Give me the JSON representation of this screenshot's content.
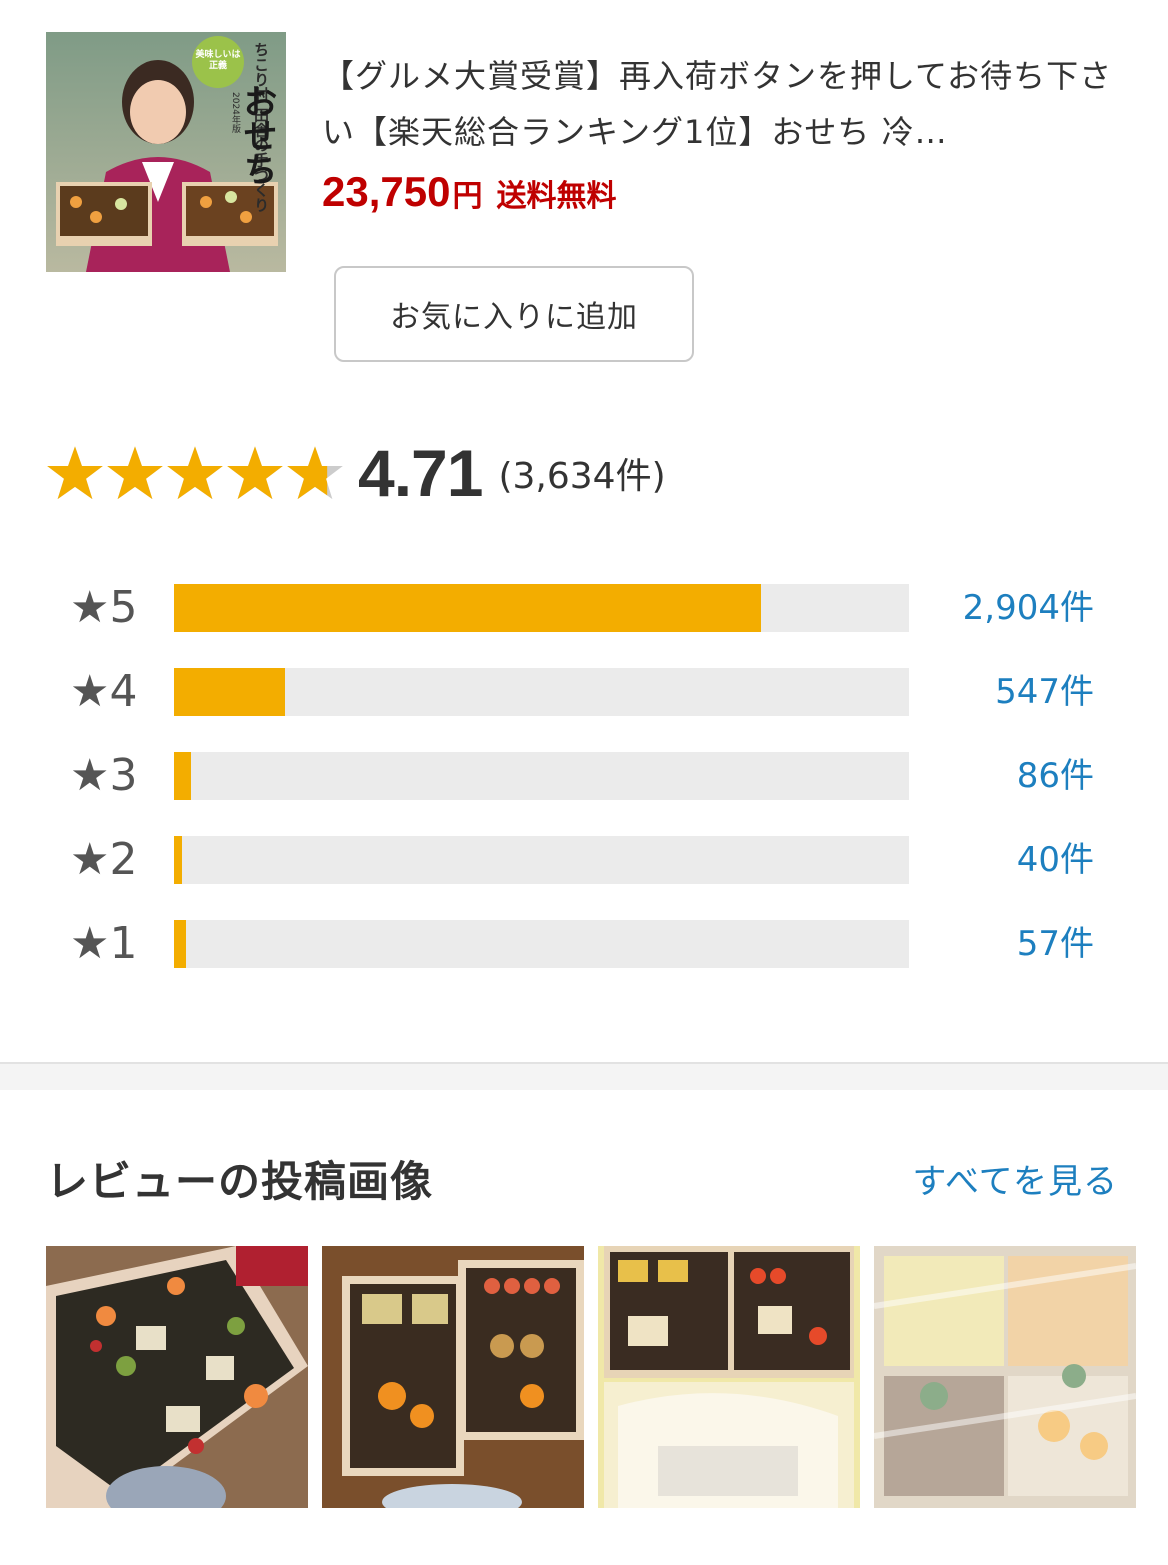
{
  "product": {
    "title": "【グルメ大賞受賞】再入荷ボタンを押してお待ち下さい【楽天総合ランキング1位】おせち 冷…",
    "price": "23,750",
    "price_unit": "円",
    "shipping": "送料無料",
    "thumbnail": {
      "badge_text": "美味しいは正義",
      "brand_text": "ちこり村 田舎の手づくり",
      "year_text": "2024年版",
      "osechi_text": "おせち"
    }
  },
  "favorite_button": {
    "label": "お気に入りに追加"
  },
  "rating": {
    "score": "4.71",
    "stars_value": 4.71,
    "count": "(3,634件)"
  },
  "distribution": [
    {
      "label": "★5",
      "count": "2,904件",
      "value": 2904
    },
    {
      "label": "★4",
      "count": "547件",
      "value": 547
    },
    {
      "label": "★3",
      "count": "86件",
      "value": 86
    },
    {
      "label": "★2",
      "count": "40件",
      "value": 40
    },
    {
      "label": "★1",
      "count": "57件",
      "value": 57
    }
  ],
  "review_images": {
    "title": "レビューの投稿画像",
    "see_all": "すべてを見る",
    "photos": [
      "review-photo-1",
      "review-photo-2",
      "review-photo-3",
      "review-photo-4"
    ]
  },
  "colors": {
    "price_red": "#bf0000",
    "star_gold": "#f3ad00",
    "link_blue": "#1d7fbf",
    "bar_track": "#ebebeb"
  }
}
